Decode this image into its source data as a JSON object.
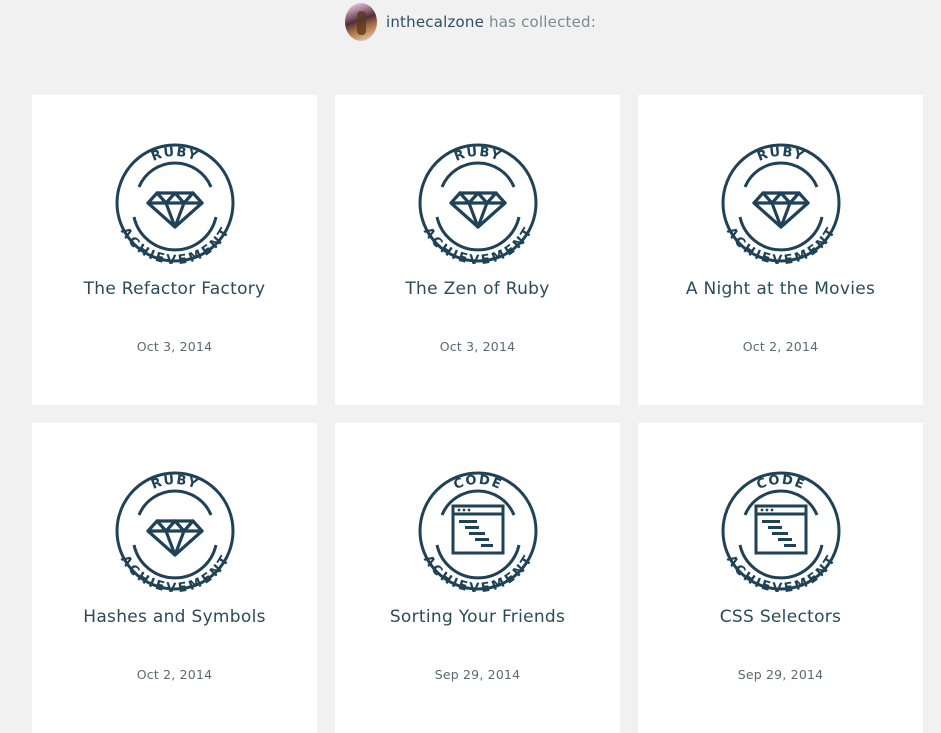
{
  "header": {
    "username": "inthecalzone",
    "suffix": " has collected:"
  },
  "colors": {
    "background": "#f0f1f0",
    "card": "#ffffff",
    "badge_stroke": "#1f4256"
  },
  "badges": [
    {
      "title": "The Refactor Factory",
      "date": "Oct 3, 2014",
      "top_label": "RUBY",
      "bottom_label": "ACHIEVEMENT",
      "icon": "ruby-gem-icon"
    },
    {
      "title": "The Zen of Ruby",
      "date": "Oct 3, 2014",
      "top_label": "RUBY",
      "bottom_label": "ACHIEVEMENT",
      "icon": "ruby-gem-icon"
    },
    {
      "title": "A Night at the Movies",
      "date": "Oct 2, 2014",
      "top_label": "RUBY",
      "bottom_label": "ACHIEVEMENT",
      "icon": "ruby-gem-icon"
    },
    {
      "title": "Hashes and Symbols",
      "date": "Oct 2, 2014",
      "top_label": "RUBY",
      "bottom_label": "ACHIEVEMENT",
      "icon": "ruby-gem-icon"
    },
    {
      "title": "Sorting Your Friends",
      "date": "Sep 29, 2014",
      "top_label": "CODE",
      "bottom_label": "ACHIEVEMENT",
      "icon": "code-window-icon"
    },
    {
      "title": "CSS Selectors",
      "date": "Sep 29, 2014",
      "top_label": "CODE",
      "bottom_label": "ACHIEVEMENT",
      "icon": "code-window-icon"
    }
  ]
}
